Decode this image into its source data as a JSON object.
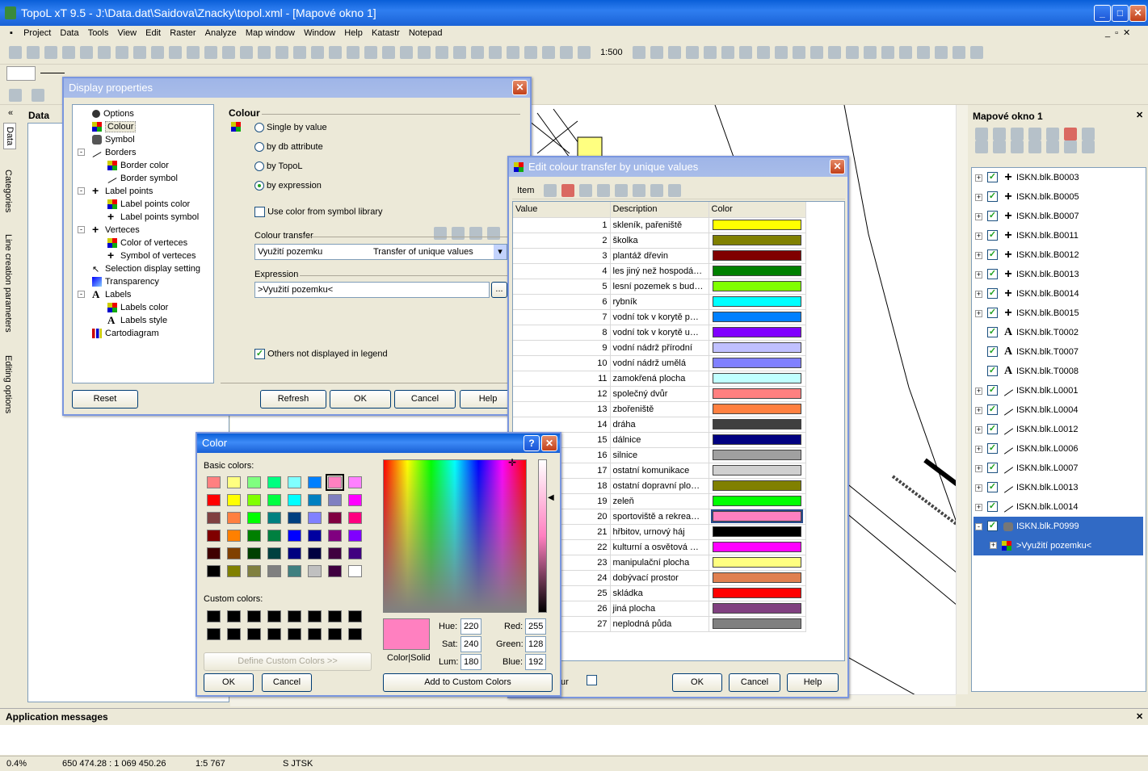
{
  "app": {
    "title": "TopoL xT 9.5 - J:\\Data.dat\\Saidova\\Znacky\\topol.xml - [Mapové okno 1]"
  },
  "menu": [
    "Project",
    "Data",
    "Tools",
    "View",
    "Edit",
    "Raster",
    "Analyze",
    "Map window",
    "Window",
    "Help",
    "Katastr",
    "Notepad"
  ],
  "toolbar": {
    "scale": "1:500"
  },
  "left_panel": {
    "title": "Data",
    "tabs": [
      "Data",
      "Categories",
      "Line creation parameters",
      "Editing options"
    ]
  },
  "display_properties": {
    "title": "Display properties",
    "tree": [
      "Options",
      "Colour",
      "Symbol",
      "Borders",
      "Border color",
      "Border symbol",
      "Label points",
      "Label points color",
      "Label points symbol",
      "Verteces",
      "Color of verteces",
      "Symbol of verteces",
      "Selection display setting",
      "Transparency",
      "Labels",
      "Labels color",
      "Labels style",
      "Cartodiagram"
    ],
    "section": "Colour",
    "options": [
      "Single by value",
      "by db attribute",
      "by TopoL",
      "by expression"
    ],
    "use_color": "Use color from symbol library",
    "transfer_label": "Colour transfer",
    "transfer_name": "Využití pozemku",
    "transfer_type": "Transfer of unique values",
    "expression_label": "Expression",
    "expression": ">Využití pozemku<",
    "others": "Others not displayed in legend",
    "buttons": {
      "reset": "Reset",
      "refresh": "Refresh",
      "ok": "OK",
      "cancel": "Cancel",
      "help": "Help"
    }
  },
  "edit_transfer": {
    "title": "Edit colour transfer by unique values",
    "item": "Item",
    "columns": [
      "Value",
      "Description",
      "Color"
    ],
    "rows": [
      {
        "v": "1",
        "d": "skleník, pařeniště",
        "c": "#ffff00"
      },
      {
        "v": "2",
        "d": "školka",
        "c": "#808000"
      },
      {
        "v": "3",
        "d": "plantáž dřevin",
        "c": "#800000"
      },
      {
        "v": "4",
        "d": "les jiný než hospodá…",
        "c": "#008000"
      },
      {
        "v": "5",
        "d": "lesní pozemek s bud…",
        "c": "#80ff00"
      },
      {
        "v": "6",
        "d": "rybník",
        "c": "#00ffff"
      },
      {
        "v": "7",
        "d": "vodní tok v korytě p…",
        "c": "#0080ff"
      },
      {
        "v": "8",
        "d": "vodní tok v korytě u…",
        "c": "#8000ff"
      },
      {
        "v": "9",
        "d": "vodní nádrž přírodní",
        "c": "#c0c0ff"
      },
      {
        "v": "10",
        "d": "vodní nádrž umělá",
        "c": "#8080ff"
      },
      {
        "v": "11",
        "d": "zamokřená plocha",
        "c": "#c0ffff"
      },
      {
        "v": "12",
        "d": "společný dvůr",
        "c": "#ff8080"
      },
      {
        "v": "13",
        "d": "zbořeniště",
        "c": "#ff8040"
      },
      {
        "v": "14",
        "d": "dráha",
        "c": "#404040"
      },
      {
        "v": "15",
        "d": "dálnice",
        "c": "#000080"
      },
      {
        "v": "16",
        "d": "silnice",
        "c": "#a0a0a0"
      },
      {
        "v": "17",
        "d": "ostatní komunikace",
        "c": "#d0d0d0"
      },
      {
        "v": "18",
        "d": "ostatní dopravní plo…",
        "c": "#808000"
      },
      {
        "v": "19",
        "d": "zeleň",
        "c": "#00ff00"
      },
      {
        "v": "20",
        "d": "sportoviště a rekrea…",
        "c": "#ff80c0"
      },
      {
        "v": "21",
        "d": "hřbitov, urnový háj",
        "c": "#000000"
      },
      {
        "v": "22",
        "d": "kulturní a osvětová …",
        "c": "#ff00ff"
      },
      {
        "v": "23",
        "d": "manipulační plocha",
        "c": "#ffff80"
      },
      {
        "v": "24",
        "d": "dobývací prostor",
        "c": "#e08050"
      },
      {
        "v": "25",
        "d": "skládka",
        "c": "#ff0000"
      },
      {
        "v": "26",
        "d": "jiná plocha",
        "c": "#804080"
      },
      {
        "v": "27",
        "d": "neplodná půda",
        "c": "#808080"
      }
    ],
    "partial_label": "ur",
    "buttons": {
      "ok": "OK",
      "cancel": "Cancel",
      "help": "Help"
    }
  },
  "color_dialog": {
    "title": "Color",
    "basic_label": "Basic colors:",
    "custom_label": "Custom colors:",
    "define": "Define Custom Colors >>",
    "ok": "OK",
    "cancel": "Cancel",
    "add": "Add to Custom Colors",
    "colorsolid": "Color|Solid",
    "hue_label": "Hue:",
    "sat_label": "Sat:",
    "lum_label": "Lum:",
    "red_label": "Red:",
    "green_label": "Green:",
    "blue_label": "Blue:",
    "hue": "220",
    "sat": "240",
    "lum": "180",
    "red": "255",
    "green": "128",
    "blue": "192",
    "basic_colors": [
      "#ff8080",
      "#ffff80",
      "#80ff80",
      "#00ff80",
      "#80ffff",
      "#0080ff",
      "#ff80c0",
      "#ff80ff",
      "#ff0000",
      "#ffff00",
      "#80ff00",
      "#00ff40",
      "#00ffff",
      "#0080c0",
      "#8080c0",
      "#ff00ff",
      "#804040",
      "#ff8040",
      "#00ff00",
      "#008080",
      "#004080",
      "#8080ff",
      "#800040",
      "#ff0080",
      "#800000",
      "#ff8000",
      "#008000",
      "#008040",
      "#0000ff",
      "#0000a0",
      "#800080",
      "#8000ff",
      "#400000",
      "#804000",
      "#004000",
      "#004040",
      "#000080",
      "#000040",
      "#400040",
      "#400080",
      "#000000",
      "#808000",
      "#808040",
      "#808080",
      "#408080",
      "#c0c0c0",
      "#400040",
      "#ffffff"
    ],
    "selected": "#ff80c0"
  },
  "map_window": {
    "title": "Mapové okno 1",
    "layers": [
      {
        "name": "ISKN.blk.B0003",
        "icon": "plus"
      },
      {
        "name": "ISKN.blk.B0005",
        "icon": "plus"
      },
      {
        "name": "ISKN.blk.B0007",
        "icon": "plus"
      },
      {
        "name": "ISKN.blk.B0011",
        "icon": "plus"
      },
      {
        "name": "ISKN.blk.B0012",
        "icon": "plus"
      },
      {
        "name": "ISKN.blk.B0013",
        "icon": "plus"
      },
      {
        "name": "ISKN.blk.B0014",
        "icon": "plus"
      },
      {
        "name": "ISKN.blk.B0015",
        "icon": "plus"
      },
      {
        "name": "ISKN.blk.T0002",
        "icon": "A"
      },
      {
        "name": "ISKN.blk.T0007",
        "icon": "A"
      },
      {
        "name": "ISKN.blk.T0008",
        "icon": "A"
      },
      {
        "name": "ISKN.blk.L0001",
        "icon": "line"
      },
      {
        "name": "ISKN.blk.L0004",
        "icon": "line"
      },
      {
        "name": "ISKN.blk.L0012",
        "icon": "line"
      },
      {
        "name": "ISKN.blk.L0006",
        "icon": "line"
      },
      {
        "name": "ISKN.blk.L0007",
        "icon": "line"
      },
      {
        "name": "ISKN.blk.L0013",
        "icon": "line"
      },
      {
        "name": "ISKN.blk.L0014",
        "icon": "line"
      },
      {
        "name": "ISKN.blk.P0999",
        "icon": "poly"
      }
    ],
    "sublayer": ">Využití pozemku<"
  },
  "messages": {
    "title": "Application messages"
  },
  "status": {
    "zoom": "0.4%",
    "coords": "650 474.28 : 1 069 450.26",
    "scale": "1:5 767",
    "crs": "S JTSK"
  }
}
